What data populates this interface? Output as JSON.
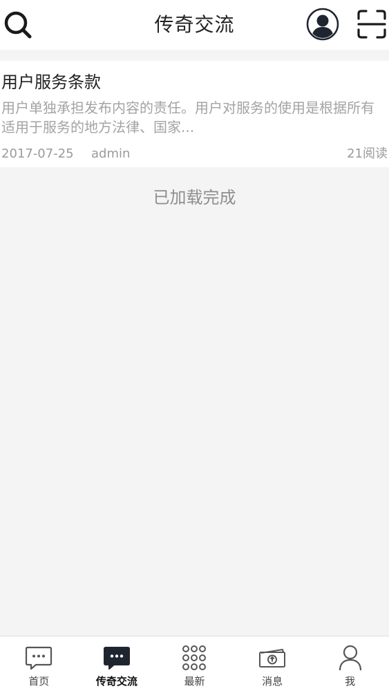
{
  "header": {
    "title": "传奇交流",
    "icons": {
      "left": "search-icon",
      "right1": "user-avatar-icon",
      "right2": "scan-icon"
    }
  },
  "post": {
    "title": "用户服务条款",
    "summary": "用户单独承担发布内容的责任。用户对服务的使用是根据所有适用于服务的地方法律、国家...",
    "date": "2017-07-25",
    "author": "admin",
    "reads": "21阅读"
  },
  "status": {
    "loaded": "已加载完成"
  },
  "tabbar": {
    "active_index": 1,
    "items": [
      {
        "label": "首页",
        "icon": "chat-bubble-outline-icon"
      },
      {
        "label": "传奇交流",
        "icon": "chat-bubble-filled-icon"
      },
      {
        "label": "最新",
        "icon": "dot-grid-icon"
      },
      {
        "label": "消息",
        "icon": "money-bill-icon"
      },
      {
        "label": "我",
        "icon": "person-outline-icon"
      }
    ]
  },
  "colors": {
    "background": "#f4f4f4",
    "card": "#ffffff",
    "text_primary": "#222222",
    "text_muted": "#a3a3a3",
    "icon_dark": "#1f2530"
  }
}
